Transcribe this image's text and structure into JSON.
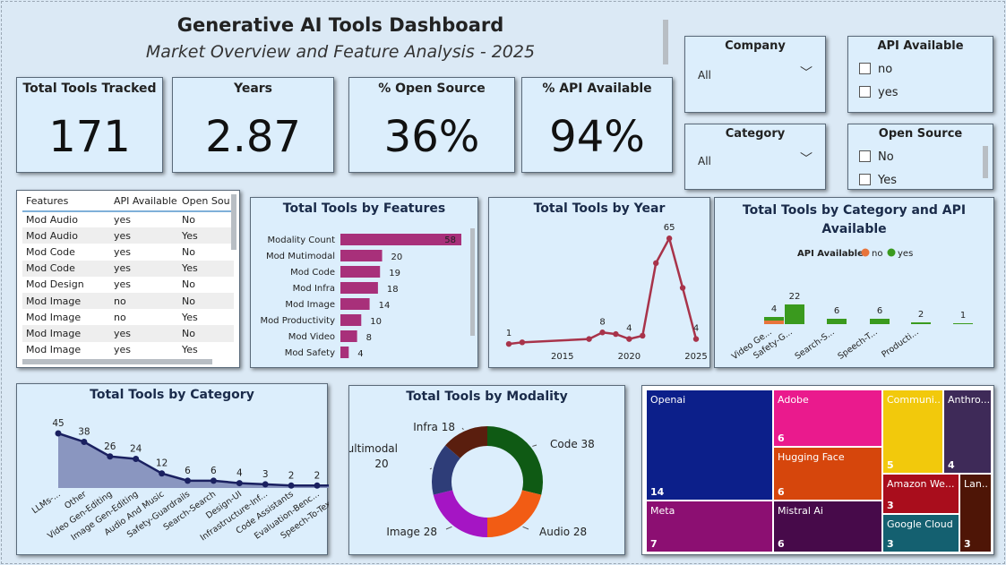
{
  "header": {
    "title": "Generative AI Tools Dashboard",
    "subtitle": "Market Overview and Feature Analysis - 2025"
  },
  "kpis": {
    "total_tools": {
      "label": "Total Tools Tracked",
      "value": "171"
    },
    "years": {
      "label": "Years",
      "value": "2.87"
    },
    "open_source": {
      "label": "% Open Source",
      "value": "36%",
      "fraction": 0.36
    },
    "api_available": {
      "label": "% API Available",
      "value": "94%",
      "fraction": 0.94
    }
  },
  "slicers": {
    "company": {
      "title": "Company",
      "value": "All"
    },
    "category": {
      "title": "Category",
      "value": "All"
    },
    "api": {
      "title": "API Available",
      "options": [
        "no",
        "yes"
      ]
    },
    "open_source": {
      "title": "Open Source",
      "options": [
        "No",
        "Yes"
      ]
    }
  },
  "table": {
    "headers": [
      "Features",
      "API Available",
      "Open Sou"
    ],
    "rows": [
      [
        "Mod Audio",
        "yes",
        "No"
      ],
      [
        "Mod Audio",
        "yes",
        "Yes"
      ],
      [
        "Mod Code",
        "yes",
        "No"
      ],
      [
        "Mod Code",
        "yes",
        "Yes"
      ],
      [
        "Mod Design",
        "yes",
        "No"
      ],
      [
        "Mod Image",
        "no",
        "No"
      ],
      [
        "Mod Image",
        "no",
        "Yes"
      ],
      [
        "Mod Image",
        "yes",
        "No"
      ],
      [
        "Mod Image",
        "yes",
        "Yes"
      ]
    ]
  },
  "chart_data": [
    {
      "id": "features",
      "type": "bar",
      "orientation": "horizontal",
      "title": "Total Tools by Features",
      "categories": [
        "Modality Count",
        "Mod Mutimodal",
        "Mod Code",
        "Mod Infra",
        "Mod Image",
        "Mod Productivity",
        "Mod Video",
        "Mod Safety"
      ],
      "values": [
        58,
        20,
        19,
        18,
        14,
        10,
        8,
        4
      ],
      "color": "#a8307a"
    },
    {
      "id": "year",
      "type": "line",
      "title": "Total Tools by Year",
      "x": [
        2011,
        2012,
        2017,
        2018,
        2019,
        2020,
        2021,
        2022,
        2023,
        2024,
        2025
      ],
      "values": [
        1,
        2,
        4,
        8,
        7,
        4,
        6,
        50,
        65,
        35,
        4
      ],
      "data_labels": [
        [
          "2011",
          "1"
        ],
        [
          "2018",
          "8"
        ],
        [
          "2020",
          "4"
        ],
        [
          "2023",
          "65"
        ],
        [
          "2025",
          "4"
        ]
      ],
      "x_ticks": [
        "2015",
        "2020",
        "2025"
      ],
      "color": "#a8334a"
    },
    {
      "id": "category_api",
      "type": "bar",
      "title": "Total Tools by Category and API Available",
      "legend_title": "API Available",
      "legend_position": "top",
      "categories": [
        "Video Ge...",
        "Safety-G...",
        "Search-S...",
        "Speech-T...",
        "Producti...",
        ""
      ],
      "series": [
        {
          "name": "no",
          "color": "#e8743b",
          "values": [
            4,
            0,
            0,
            0,
            0,
            0
          ]
        },
        {
          "name": "yes",
          "color": "#3a9a1e",
          "values": [
            4,
            22,
            6,
            6,
            2,
            1
          ]
        }
      ],
      "data_labels": [
        "4",
        "22",
        "6",
        "6",
        "2",
        "1"
      ]
    },
    {
      "id": "category",
      "type": "area",
      "title": "Total Tools by Category",
      "categories": [
        "LLMs-...",
        "Other",
        "Video Gen-Editing",
        "Image Gen-Editing",
        "Audio And Music",
        "Safety-Guardrails",
        "Search-Search",
        "Design-UI",
        "Infrastructure-Inf...",
        "Code Assistants",
        "Evaluation-Benc...",
        "Speech-To-Text (..."
      ],
      "values": [
        45,
        38,
        26,
        24,
        12,
        6,
        6,
        4,
        3,
        2,
        2,
        2
      ],
      "color": "#1a2060",
      "fill": "#8a96c0"
    },
    {
      "id": "modality",
      "type": "pie",
      "title": "Total Tools by Modality",
      "slices": [
        {
          "label": "Code",
          "value": 38,
          "color": "#0f5a14"
        },
        {
          "label": "Audio",
          "value": 28,
          "color": "#f25c14"
        },
        {
          "label": "Image",
          "value": 28,
          "color": "#a515c4"
        },
        {
          "label": "Multimodal",
          "value": 20,
          "color": "#2e3d78"
        },
        {
          "label": "Infra",
          "value": 18,
          "color": "#5a1e0e"
        }
      ]
    },
    {
      "id": "company",
      "type": "treemap",
      "items": [
        {
          "label": "Openai",
          "value": 14,
          "color": "#0c1f8a"
        },
        {
          "label": "Adobe",
          "value": 6,
          "color": "#ea1a8d"
        },
        {
          "label": "Hugging Face",
          "value": 6,
          "color": "#d6460c"
        },
        {
          "label": "Communi...",
          "value": 5,
          "color": "#f2c90c"
        },
        {
          "label": "Anthro...",
          "value": 4,
          "color": "#3e2a58"
        },
        {
          "label": "Meta",
          "value": 7,
          "color": "#8c0f72"
        },
        {
          "label": "Mistral Ai",
          "value": 6,
          "color": "#470a4a"
        },
        {
          "label": "Amazon We...",
          "value": 3,
          "color": "#a90d1c"
        },
        {
          "label": "Google Cloud",
          "value": 3,
          "color": "#146070"
        },
        {
          "label": "Lan...",
          "value": 3,
          "color": "#4e1506"
        }
      ]
    }
  ]
}
